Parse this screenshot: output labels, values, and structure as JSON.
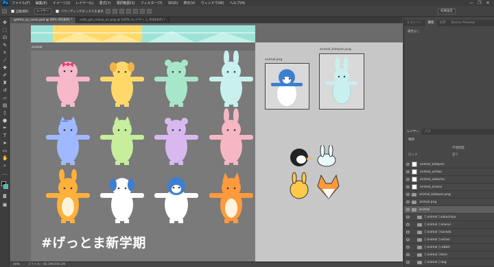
{
  "app": {
    "logo": "Ps"
  },
  "menu": [
    "ファイル(F)",
    "編集(E)",
    "イメージ(I)",
    "レイヤー(L)",
    "書式(Y)",
    "選択範囲(S)",
    "フィルター(T)",
    "3D(D)",
    "表示(V)",
    "ウィンドウ(W)",
    "ヘルプ(H)"
  ],
  "window_controls": [
    "—",
    "❐",
    "✕"
  ],
  "options": {
    "auto_select_label": "自動選択：",
    "auto_select_value": "レイヤー",
    "show_transform_label": "バウンディングボックスを表示",
    "workspace_value": "初期設定"
  },
  "doc_tabs": [
    {
      "label": "getmo_cp_sosai.psd @ 40% (RGB/8) *",
      "active": true
    },
    {
      "label": "note_gm_mikuz_ac.png @ 100% (レイヤー 1, RGB/8#) *",
      "active": false
    }
  ],
  "canvas": {
    "artboard_label": "animal",
    "thumb1_label": "animal.png",
    "thumb2_label": "animal_katopan.png",
    "hashtag": "#げっとま新学期"
  },
  "status": {
    "zoom": "40%",
    "doc_info": "ファイル：65.1M/359.2M"
  },
  "panel_top": {
    "tabs": [
      "ヒストリー",
      "属性",
      "文字",
      "Device Preview"
    ],
    "no_properties": "属性なし"
  },
  "layers_panel": {
    "tabs": [
      "レイヤー",
      "パス"
    ],
    "kind_label": "種類",
    "opacity_label": "不透明度",
    "fill_label": "塗り",
    "lock_label": "ロック",
    "rows": [
      {
        "name": "animal_katopan",
        "kind": "thumb",
        "selected": false
      },
      {
        "name": "animal_uchiwi",
        "kind": "thumb",
        "selected": false
      },
      {
        "name": "animal_sakachu",
        "kind": "thumb",
        "selected": false
      },
      {
        "name": "animal_anasui",
        "kind": "thumb",
        "selected": false
      },
      {
        "name": "animal_katopan.png",
        "kind": "folder",
        "selected": false
      },
      {
        "name": "animal.png",
        "kind": "folder",
        "selected": false
      },
      {
        "name": "animal",
        "kind": "folder",
        "selected": true
      },
      {
        "name": "[ animal ] sakachiya",
        "kind": "folder",
        "selected": false
      },
      {
        "name": "[ animal ] anasui",
        "kind": "folder",
        "selected": false
      },
      {
        "name": "[ animal ] karada",
        "kind": "folder",
        "selected": false
      },
      {
        "name": "[ animal ] ochan",
        "kind": "folder",
        "selected": false
      },
      {
        "name": "[ animal ] rabbit",
        "kind": "folder",
        "selected": false
      },
      {
        "name": "[ animal ] bani",
        "kind": "folder",
        "selected": false
      },
      {
        "name": "[ animal ] dog",
        "kind": "folder",
        "selected": false
      }
    ]
  },
  "colors": {
    "pink": "#f7b8c9",
    "yellow": "#ffd86a",
    "mint": "#a8e6c9",
    "aqua": "#c9f0ef",
    "blue": "#9fb8ff",
    "green": "#c6ee9c",
    "lilac": "#d9b8f0",
    "rose": "#f7b6c4",
    "orange": "#ffb13b",
    "white": "#ffffff",
    "penguin_blue": "#3c7fd2",
    "fox": "#ff9a3c"
  }
}
